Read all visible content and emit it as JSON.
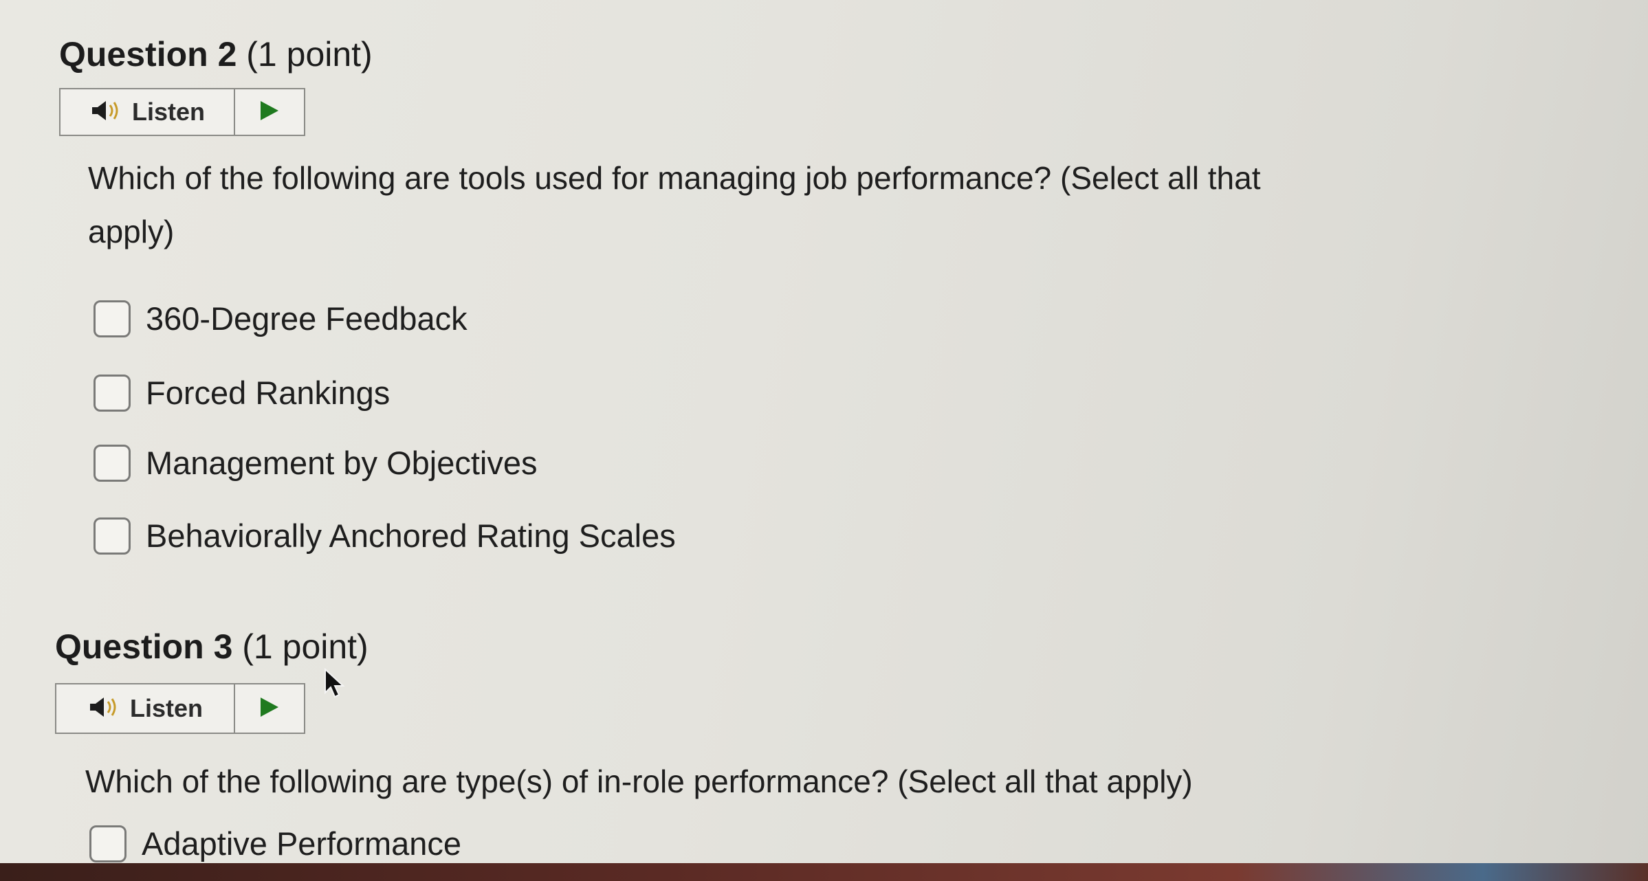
{
  "questions": [
    {
      "label": "Question 2",
      "points": "(1 point)",
      "listen_label": "Listen",
      "prompt_line1": "Which of the following are tools used for managing job performance? (Select all that",
      "prompt_line2": "apply)",
      "options": [
        {
          "label": "360-Degree Feedback",
          "checked": false
        },
        {
          "label": "Forced Rankings",
          "checked": false
        },
        {
          "label": "Management by Objectives",
          "checked": false
        },
        {
          "label": "Behaviorally Anchored Rating Scales",
          "checked": false
        }
      ]
    },
    {
      "label": "Question 3",
      "points": "(1 point)",
      "listen_label": "Listen",
      "prompt_line1": "Which of the following are type(s) of in-role performance? (Select all that apply)",
      "options": [
        {
          "label": "Adaptive Performance",
          "checked": false
        }
      ]
    }
  ],
  "icons": {
    "speaker": "speaker-icon",
    "play": "play-icon",
    "cursor": "mouse-pointer-icon"
  },
  "colors": {
    "play_green": "#1f7a1f",
    "border": "#8a8a86"
  }
}
